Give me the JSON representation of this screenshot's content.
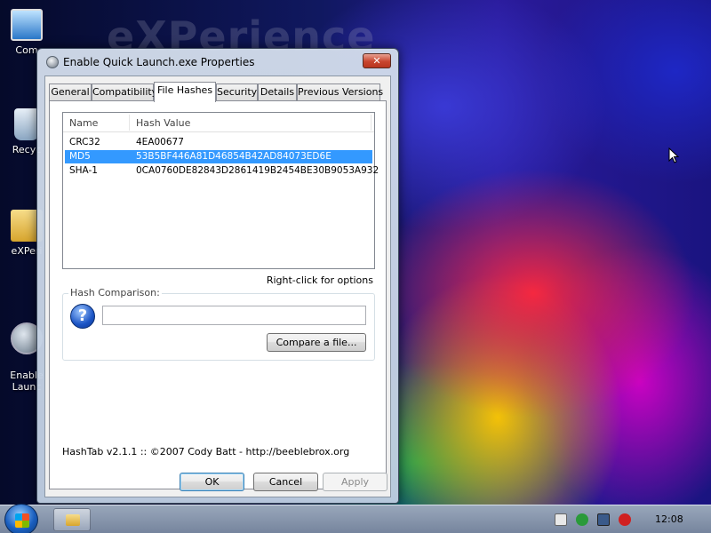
{
  "desktop": {
    "wallpaper_text": "eXPerience",
    "icons": [
      {
        "label": "Com"
      },
      {
        "label": "Recyc"
      },
      {
        "label": "eXPeri"
      },
      {
        "label": "Enable\nLaunc"
      }
    ]
  },
  "window": {
    "title": "Enable Quick Launch.exe Properties",
    "close_label": "✕",
    "tabs": [
      {
        "label": "General"
      },
      {
        "label": "Compatibility"
      },
      {
        "label": "File Hashes"
      },
      {
        "label": "Security"
      },
      {
        "label": "Details"
      },
      {
        "label": "Previous Versions"
      }
    ],
    "active_tab": "File Hashes",
    "list": {
      "columns": [
        "Name",
        "Hash Value"
      ],
      "rows": [
        {
          "name": "CRC32",
          "value": "4EA00677",
          "selected": false
        },
        {
          "name": "MD5",
          "value": "53B5BF446A81D46854B42AD84073ED6E",
          "selected": true
        },
        {
          "name": "SHA-1",
          "value": "0CA0760DE82843D2861419B2454BE30B9053A932",
          "selected": false
        }
      ]
    },
    "right_click_hint": "Right-click for options",
    "hash_comparison": {
      "label": "Hash Comparison:",
      "input_value": "",
      "help_glyph": "?",
      "compare_button": "Compare a file..."
    },
    "credit": "HashTab v2.1.1 :: ©2007 Cody Batt  -  http://beeblebrox.org",
    "buttons": {
      "ok": "OK",
      "cancel": "Cancel",
      "apply": "Apply"
    }
  },
  "taskbar": {
    "clock": "12:08"
  },
  "colors": {
    "selection": "#3399ff",
    "close_button": "#c8452e"
  }
}
